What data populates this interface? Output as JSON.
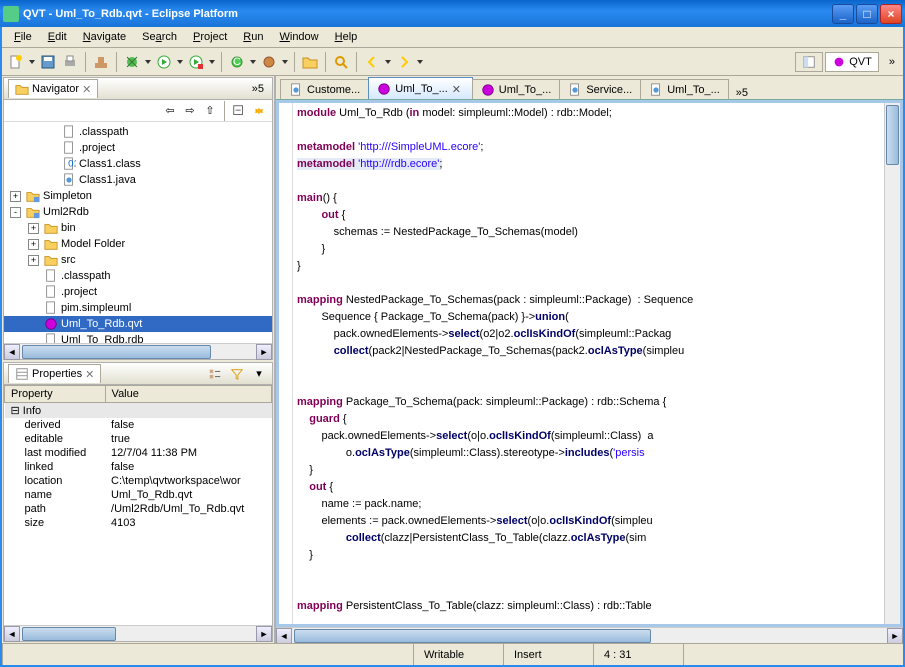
{
  "window": {
    "title": "QVT - Uml_To_Rdb.qvt - Eclipse Platform"
  },
  "menu": {
    "file": "File",
    "edit": "Edit",
    "navigate": "Navigate",
    "search": "Search",
    "project": "Project",
    "run": "Run",
    "window": "Window",
    "help": "Help"
  },
  "perspectives": {
    "qvt": "QVT"
  },
  "navigator": {
    "title": "Navigator",
    "overflow": "5",
    "tree": [
      {
        "indent": 2,
        "tw": "",
        "icon": "file",
        "label": ".classpath"
      },
      {
        "indent": 2,
        "tw": "",
        "icon": "file",
        "label": ".project"
      },
      {
        "indent": 2,
        "tw": "",
        "icon": "class",
        "label": "Class1.class"
      },
      {
        "indent": 2,
        "tw": "",
        "icon": "java",
        "label": "Class1.java"
      },
      {
        "indent": 0,
        "tw": "+",
        "icon": "proj",
        "label": "Simpleton"
      },
      {
        "indent": 0,
        "tw": "-",
        "icon": "proj",
        "label": "Uml2Rdb"
      },
      {
        "indent": 1,
        "tw": "+",
        "icon": "folder",
        "label": "bin"
      },
      {
        "indent": 1,
        "tw": "+",
        "icon": "folder",
        "label": "Model Folder"
      },
      {
        "indent": 1,
        "tw": "+",
        "icon": "folder",
        "label": "src"
      },
      {
        "indent": 1,
        "tw": "",
        "icon": "file",
        "label": ".classpath"
      },
      {
        "indent": 1,
        "tw": "",
        "icon": "file",
        "label": ".project"
      },
      {
        "indent": 1,
        "tw": "",
        "icon": "file",
        "label": "pim.simpleuml"
      },
      {
        "indent": 1,
        "tw": "",
        "icon": "qvt",
        "label": "Uml_To_Rdb.qvt",
        "sel": true
      },
      {
        "indent": 1,
        "tw": "",
        "icon": "file",
        "label": "Uml_To_Rdb.rdb"
      }
    ]
  },
  "properties": {
    "title": "Properties",
    "col_prop": "Property",
    "col_val": "Value",
    "info": "Info",
    "rows": [
      {
        "p": "derived",
        "v": "false"
      },
      {
        "p": "editable",
        "v": "true"
      },
      {
        "p": "last modified",
        "v": "12/7/04 11:38 PM"
      },
      {
        "p": "linked",
        "v": "false"
      },
      {
        "p": "location",
        "v": "C:\\temp\\qvtworkspace\\wor"
      },
      {
        "p": "name",
        "v": "Uml_To_Rdb.qvt"
      },
      {
        "p": "path",
        "v": "/Uml2Rdb/Uml_To_Rdb.qvt"
      },
      {
        "p": "size",
        "v": "4103"
      }
    ]
  },
  "tabs": [
    {
      "label": "Custome...",
      "icon": "java"
    },
    {
      "label": "Uml_To_...",
      "icon": "qvt",
      "active": true,
      "close": true
    },
    {
      "label": "Uml_To_...",
      "icon": "qvt"
    },
    {
      "label": "Service...",
      "icon": "java"
    },
    {
      "label": "Uml_To_...",
      "icon": "java"
    }
  ],
  "tabs_overflow": "»5",
  "status": {
    "writable": "Writable",
    "mode": "Insert",
    "pos": "4 : 31"
  },
  "code": {
    "l1a": "module",
    "l1b": " Uml_To_Rdb (",
    "l1c": "in",
    "l1d": " model: simpleuml::Model) : rdb::Model;",
    "l3a": "metamodel",
    "l3b": " ",
    "l3c": "'http:///SimpleUML.ecore'",
    "l3d": ";",
    "l4a": "metamodel",
    "l4b": " ",
    "l4c": "'http:///rdb.ecore'",
    "l4d": ";",
    "l6a": "main",
    "l6b": "() {",
    "l7a": "        ",
    "l7b": "out",
    "l7c": " {",
    "l8": "            schemas := NestedPackage_To_Schemas(model)",
    "l9": "        }",
    "l10": "}",
    "l12a": "mapping",
    "l12b": " NestedPackage_To_Schemas(pack : simpleuml::Package)  : Sequence",
    "l13a": "        Sequence { Package_To_Schema(pack) }->",
    "l13b": "union",
    "l13c": "(",
    "l14a": "            pack.ownedElements->",
    "l14b": "select",
    "l14c": "(o2|o2.",
    "l14d": "oclIsKindOf",
    "l14e": "(simpleuml::Packag",
    "l15a": "            ",
    "l15b": "collect",
    "l15c": "(pack2|NestedPackage_To_Schemas(pack2.",
    "l15d": "oclAsType",
    "l15e": "(simpleu",
    "l18a": "mapping",
    "l18b": " Package_To_Schema(pack: simpleuml::Package) : rdb::Schema {",
    "l19a": "    ",
    "l19b": "guard",
    "l19c": " {",
    "l20a": "        pack.ownedElements->",
    "l20b": "select",
    "l20c": "(o|o.",
    "l20d": "oclIsKindOf",
    "l20e": "(simpleuml::Class)  a",
    "l21a": "                o.",
    "l21b": "oclAsType",
    "l21c": "(simpleuml::Class).stereotype->",
    "l21d": "includes",
    "l21e": "(",
    "l21f": "'persis",
    "l22": "    }",
    "l23a": "    ",
    "l23b": "out",
    "l23c": " {",
    "l24": "        name := pack.name;",
    "l25a": "        elements := pack.ownedElements->",
    "l25b": "select",
    "l25c": "(o|o.",
    "l25d": "oclIsKindOf",
    "l25e": "(simpleu",
    "l26a": "                ",
    "l26b": "collect",
    "l26c": "(clazz|PersistentClass_To_Table(clazz.",
    "l26d": "oclAsType",
    "l26e": "(sim",
    "l27": "    }",
    "l30a": "mapping",
    "l30b": " PersistentClass_To_Table(clazz: simpleuml::Class) : rdb::Table"
  }
}
